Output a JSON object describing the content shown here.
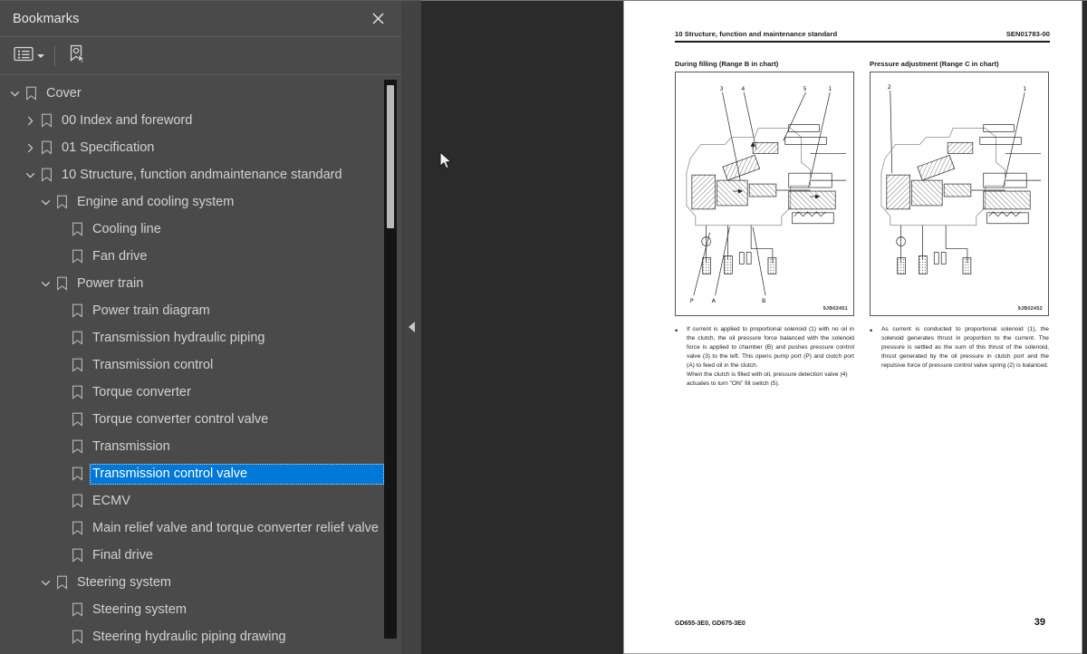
{
  "sidebar": {
    "title": "Bookmarks",
    "close_label": "×",
    "toolbar": {
      "options_icon": "list-options-icon",
      "options_caret": "chevron-down-icon",
      "new_bookmark_icon": "new-bookmark-icon"
    },
    "tree": [
      {
        "label": "Cover",
        "level": 0,
        "state": "expanded",
        "selected": false
      },
      {
        "label": "00 Index and foreword",
        "level": 1,
        "state": "collapsed",
        "selected": false
      },
      {
        "label": "01 Specification",
        "level": 1,
        "state": "collapsed",
        "selected": false
      },
      {
        "label": "10 Structure, function andmaintenance standard",
        "level": 1,
        "state": "expanded",
        "selected": false
      },
      {
        "label": "Engine and cooling system",
        "level": 2,
        "state": "expanded",
        "selected": false
      },
      {
        "label": "Cooling line",
        "level": 3,
        "state": "leaf",
        "selected": false
      },
      {
        "label": "Fan drive",
        "level": 3,
        "state": "leaf",
        "selected": false
      },
      {
        "label": "Power train",
        "level": 2,
        "state": "expanded",
        "selected": false
      },
      {
        "label": "Power train diagram",
        "level": 3,
        "state": "leaf",
        "selected": false
      },
      {
        "label": "Transmission hydraulic piping",
        "level": 3,
        "state": "leaf",
        "selected": false
      },
      {
        "label": "Transmission control",
        "level": 3,
        "state": "leaf",
        "selected": false
      },
      {
        "label": "Torque converter",
        "level": 3,
        "state": "leaf",
        "selected": false
      },
      {
        "label": "Torque converter control valve",
        "level": 3,
        "state": "leaf",
        "selected": false
      },
      {
        "label": "Transmission",
        "level": 3,
        "state": "leaf",
        "selected": false
      },
      {
        "label": "Transmission control valve",
        "level": 3,
        "state": "leaf",
        "selected": true
      },
      {
        "label": "ECMV",
        "level": 3,
        "state": "leaf",
        "selected": false
      },
      {
        "label": "Main relief valve and torque converter relief valve",
        "level": 3,
        "state": "leaf",
        "selected": false
      },
      {
        "label": "Final drive",
        "level": 3,
        "state": "leaf",
        "selected": false
      },
      {
        "label": "Steering system",
        "level": 2,
        "state": "expanded",
        "selected": false
      },
      {
        "label": "Steering system",
        "level": 3,
        "state": "leaf",
        "selected": false
      },
      {
        "label": "Steering hydraulic piping drawing",
        "level": 3,
        "state": "leaf",
        "selected": false
      }
    ],
    "selection_color": "#0078d7"
  },
  "splitter": {
    "collapse_icon": "collapse-left-triangle-icon"
  },
  "document": {
    "header_left": "10 Structure, function and maintenance standard",
    "header_right": "SEN01783-00",
    "columns": [
      {
        "title": "During filling (Range B in chart)",
        "figure_id": "9JB02451",
        "callouts_top": [
          "3",
          "4",
          "5",
          "1"
        ],
        "callouts_bottom": [
          "P",
          "A",
          "B"
        ],
        "body": "If current is applied to proportional solenoid (1) with no oil in the clutch, the oil pressure force balanced with the solenoid force is applied to chamber (B) and pushes pressure control valve (3) to the left. This opens pump port (P) and clutch port (A) to feed oil in the clutch.",
        "body2": "When the clutch is filled with oil, pressure detection valve (4) actuates to turn \"ON\" fill switch (5)."
      },
      {
        "title": "Pressure adjustment (Range C in chart)",
        "figure_id": "9JB02452",
        "callouts_top": [
          "2",
          "1"
        ],
        "callouts_bottom": [],
        "body": "As current is conducted to proportional solenoid (1), the solenoid generates thrust in proportion to the current. The pressure is settled as the sum of this thrust of the solenoid, thrust generated by the oil pressure in clutch port and the repulsive force of pressure control valve spring (2) is balanced.",
        "body2": ""
      }
    ],
    "footer_left": "GD655-3E0, GD675-3E0",
    "footer_right": "39"
  },
  "cursor": {
    "icon": "mouse-arrow-cursor"
  }
}
